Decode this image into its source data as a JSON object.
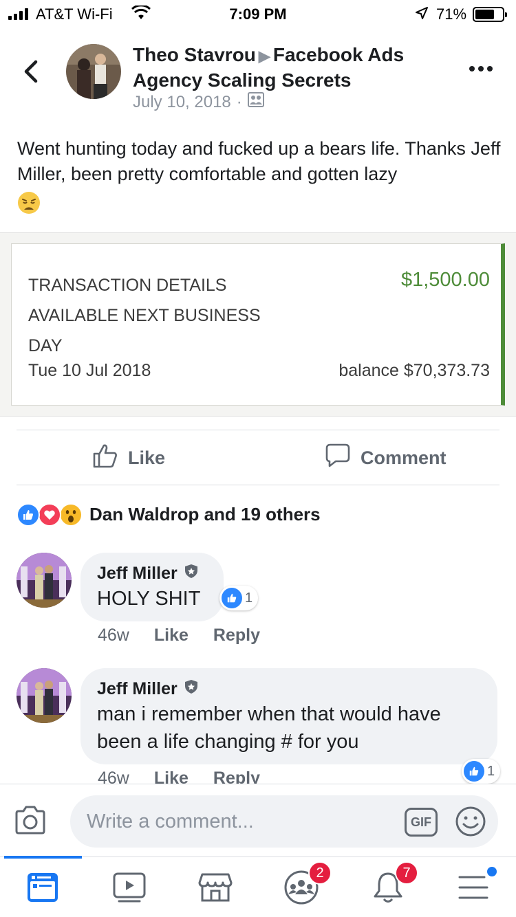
{
  "status_bar": {
    "carrier": "AT&T Wi-Fi",
    "time": "7:09 PM",
    "battery_percent": "71%",
    "battery_level": 0.71,
    "icons": [
      "signal-icon",
      "wifi-icon",
      "location-arrow-icon",
      "battery-icon"
    ]
  },
  "post": {
    "author": "Theo Stavrou",
    "group": "Facebook Ads Agency Scaling Secrets",
    "date": "July 10, 2018",
    "text": "Went hunting today and fucked up a bears life. Thanks Jeff Miller, been pretty comfortable and gotten lazy",
    "emoji": "weary-face"
  },
  "transaction": {
    "label": "TRANSACTION DETAILS AVAILABLE NEXT BUSINESS DAY",
    "amount": "$1,500.00",
    "date": "Tue 10 Jul 2018",
    "balance": "balance $70,373.73",
    "accent_color": "#4e8c39"
  },
  "actions": {
    "like": "Like",
    "comment": "Comment"
  },
  "reactions": {
    "summary": "Dan Waldrop and 19 others",
    "types": [
      "like",
      "love",
      "wow"
    ]
  },
  "comments": [
    {
      "author": "Jeff Miller",
      "text": "HOLY SHIT",
      "time": "46w",
      "like_label": "Like",
      "reply_label": "Reply",
      "reaction_count": "1"
    },
    {
      "author": "Jeff Miller",
      "text": "man i remember when that would have been a life changing # for you",
      "time": "46w",
      "like_label": "Like",
      "reply_label": "Reply",
      "reaction_count": "1"
    }
  ],
  "composer": {
    "placeholder": "Write a comment...",
    "gif_label": "GIF"
  },
  "tab_bar": {
    "tabs": [
      "news-feed",
      "watch",
      "marketplace",
      "groups",
      "notifications",
      "menu"
    ],
    "groups_badge": "2",
    "notifications_badge": "7"
  },
  "colors": {
    "facebook_blue": "#1877f2",
    "badge_red": "#e41e3f",
    "secondary_text": "#606770"
  }
}
